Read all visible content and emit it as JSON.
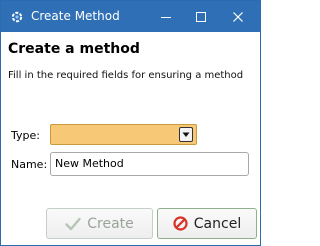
{
  "window": {
    "title": "Create Method"
  },
  "dialog": {
    "heading": "Create a method",
    "subtitle": "Fill in the required fields for ensuring a method"
  },
  "form": {
    "type_label": "Type:",
    "type_value": "",
    "name_label": "Name:",
    "name_value": "New Method"
  },
  "buttons": {
    "create_label": "Create",
    "cancel_label": "Cancel"
  },
  "icons": {
    "app": "gear-settings-icon",
    "minimize": "minimize-icon",
    "maximize": "maximize-icon",
    "close": "close-icon",
    "dropdown": "chevron-down-icon",
    "create": "check-icon",
    "cancel": "cancel-icon"
  },
  "colors": {
    "titlebar": "#2f6fb5",
    "type_field": "#f7c976",
    "create_disabled": "#9aa39a",
    "cancel_icon": "#d9342b"
  }
}
